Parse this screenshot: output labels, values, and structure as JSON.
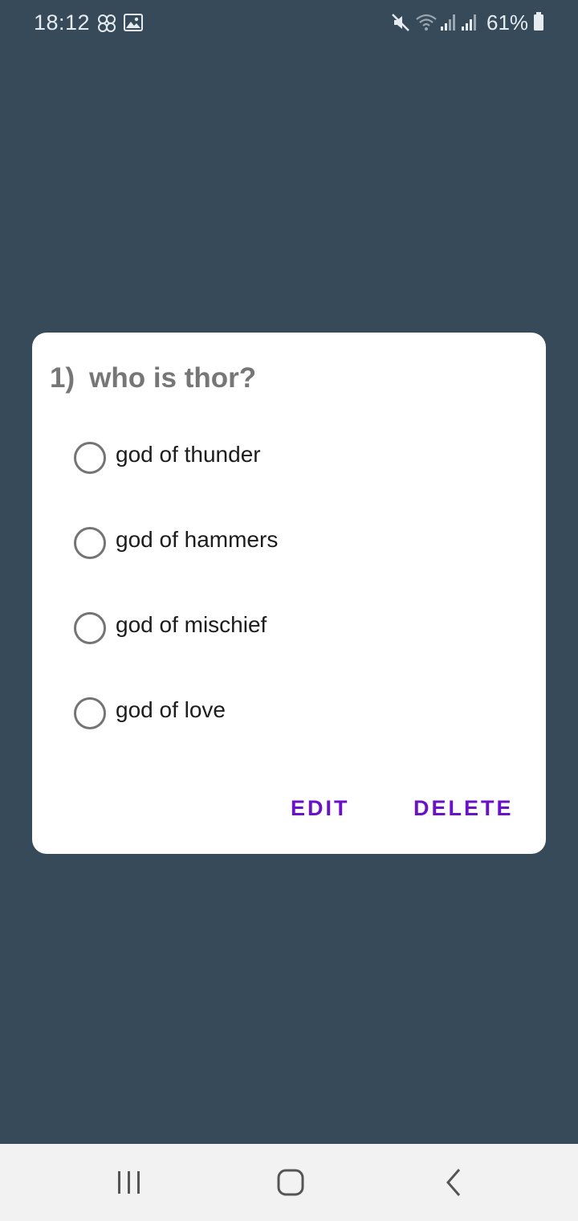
{
  "status_bar": {
    "time": "18:12",
    "battery_percent": "61%",
    "icons": [
      "flower-icon",
      "image-icon",
      "mute-icon",
      "wifi-icon",
      "signal-icon",
      "signal-icon",
      "battery-icon"
    ]
  },
  "dialog": {
    "question_number": "1)",
    "question_text": "who is thor?",
    "options": [
      {
        "label": "god of thunder",
        "selected": false
      },
      {
        "label": "god of hammers",
        "selected": false
      },
      {
        "label": "god of mischief",
        "selected": false
      },
      {
        "label": "god of love",
        "selected": false
      }
    ],
    "edit_label": "EDIT",
    "delete_label": "DELETE"
  },
  "nav_bar": {
    "buttons": [
      "recent-apps-icon",
      "home-icon",
      "back-icon"
    ]
  },
  "colors": {
    "background": "#374a59",
    "accent": "#6a12c8",
    "question_text": "#767676",
    "radio_border": "#747474"
  }
}
